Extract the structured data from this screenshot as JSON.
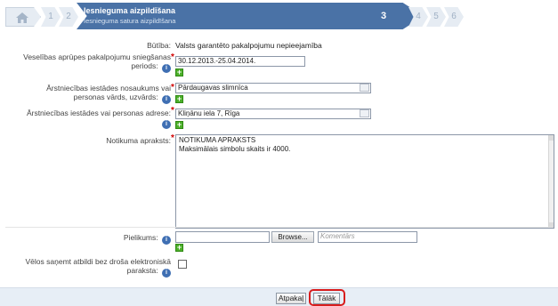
{
  "wizard": {
    "steps": [
      "1",
      "2",
      "3",
      "4",
      "5",
      "6"
    ],
    "active_title": "Iesnieguma aizpildīšana",
    "active_subtitle": "Iesnieguma satura aizpildīšana",
    "active_number": "3"
  },
  "form": {
    "butiba_label": "Būtība:",
    "butiba_value": "Valsts garantēto pakalpojumu nepieejamība",
    "period_label_l1": "Veselības aprūpes pakalpojumu sniegšanas",
    "period_label_l2": "periods:",
    "period_value": "30.12.2013.-25.04.2014.",
    "institution_label_l1": "Ārstniecības iestādes nosaukums vai",
    "institution_label_l2": "personas vārds, uzvārds:",
    "institution_value": "Pārdaugavas slimnīca",
    "address_label": "Ārstniecības iestādes vai personas adrese:",
    "address_value": "Kliņānu iela 7, Rīga",
    "description_label": "Notikuma apraksts:",
    "description_line1": "NOTIKUMA APRAKSTS",
    "description_line2": "Maksimālais simbolu skaits ir 4000.",
    "attachment_label": "Pielikums:",
    "browse_label": "Browse...",
    "comment_placeholder": "Komentārs",
    "nosign_label_l1": "Vēlos saņemt atbildi bez droša elektroniskā",
    "nosign_label_l2": "paraksta:",
    "help_glyph": "i",
    "plus_glyph": "+",
    "required_glyph": "*"
  },
  "footer": {
    "back_label": "Atpakaļ",
    "next_label": "Tālāk"
  },
  "colors": {
    "wizard_active": "#4a72a6",
    "wizard_inactive": "#e6ecf3",
    "required": "#d00000",
    "add_button": "#4caf2a",
    "highlight": "#d81d1d",
    "footer_bg": "#e7eef6"
  }
}
